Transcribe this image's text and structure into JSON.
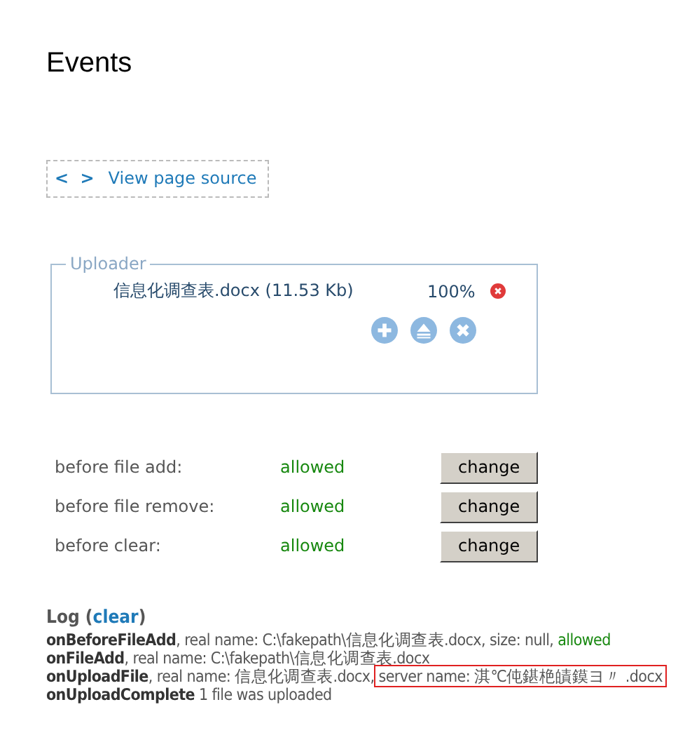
{
  "title": "Events",
  "source_link": {
    "icon": "< >",
    "label": "View page source"
  },
  "uploader": {
    "legend": "Uploader",
    "files": [
      {
        "name": "信息化调查表.docx (11.53 Kb)",
        "percent": "100%"
      }
    ]
  },
  "settings": [
    {
      "label": "before file add:",
      "value": "allowed",
      "button": "change"
    },
    {
      "label": "before file remove:",
      "value": "allowed",
      "button": "change"
    },
    {
      "label": "before clear:",
      "value": "allowed",
      "button": "change"
    }
  ],
  "log": {
    "title": "Log (",
    "clear": "clear",
    "title_end": ")",
    "entries": [
      {
        "event": "onBeforeFileAdd",
        "text": ", real name: C:\\fakepath\\信息化调查表.docx, size: null, ",
        "status": "allowed"
      },
      {
        "event": "onFileAdd",
        "text": ", real name: C:\\fakepath\\信息化调查表.docx"
      },
      {
        "event": "onUploadFile",
        "text": ", real name: 信息化调查表.docx,",
        "highlight": "server name: 淇℃伅鍖栬皟鏌ヨ〃 .docx"
      },
      {
        "event": "onUploadComplete",
        "text": " 1 file was uploaded"
      }
    ]
  }
}
